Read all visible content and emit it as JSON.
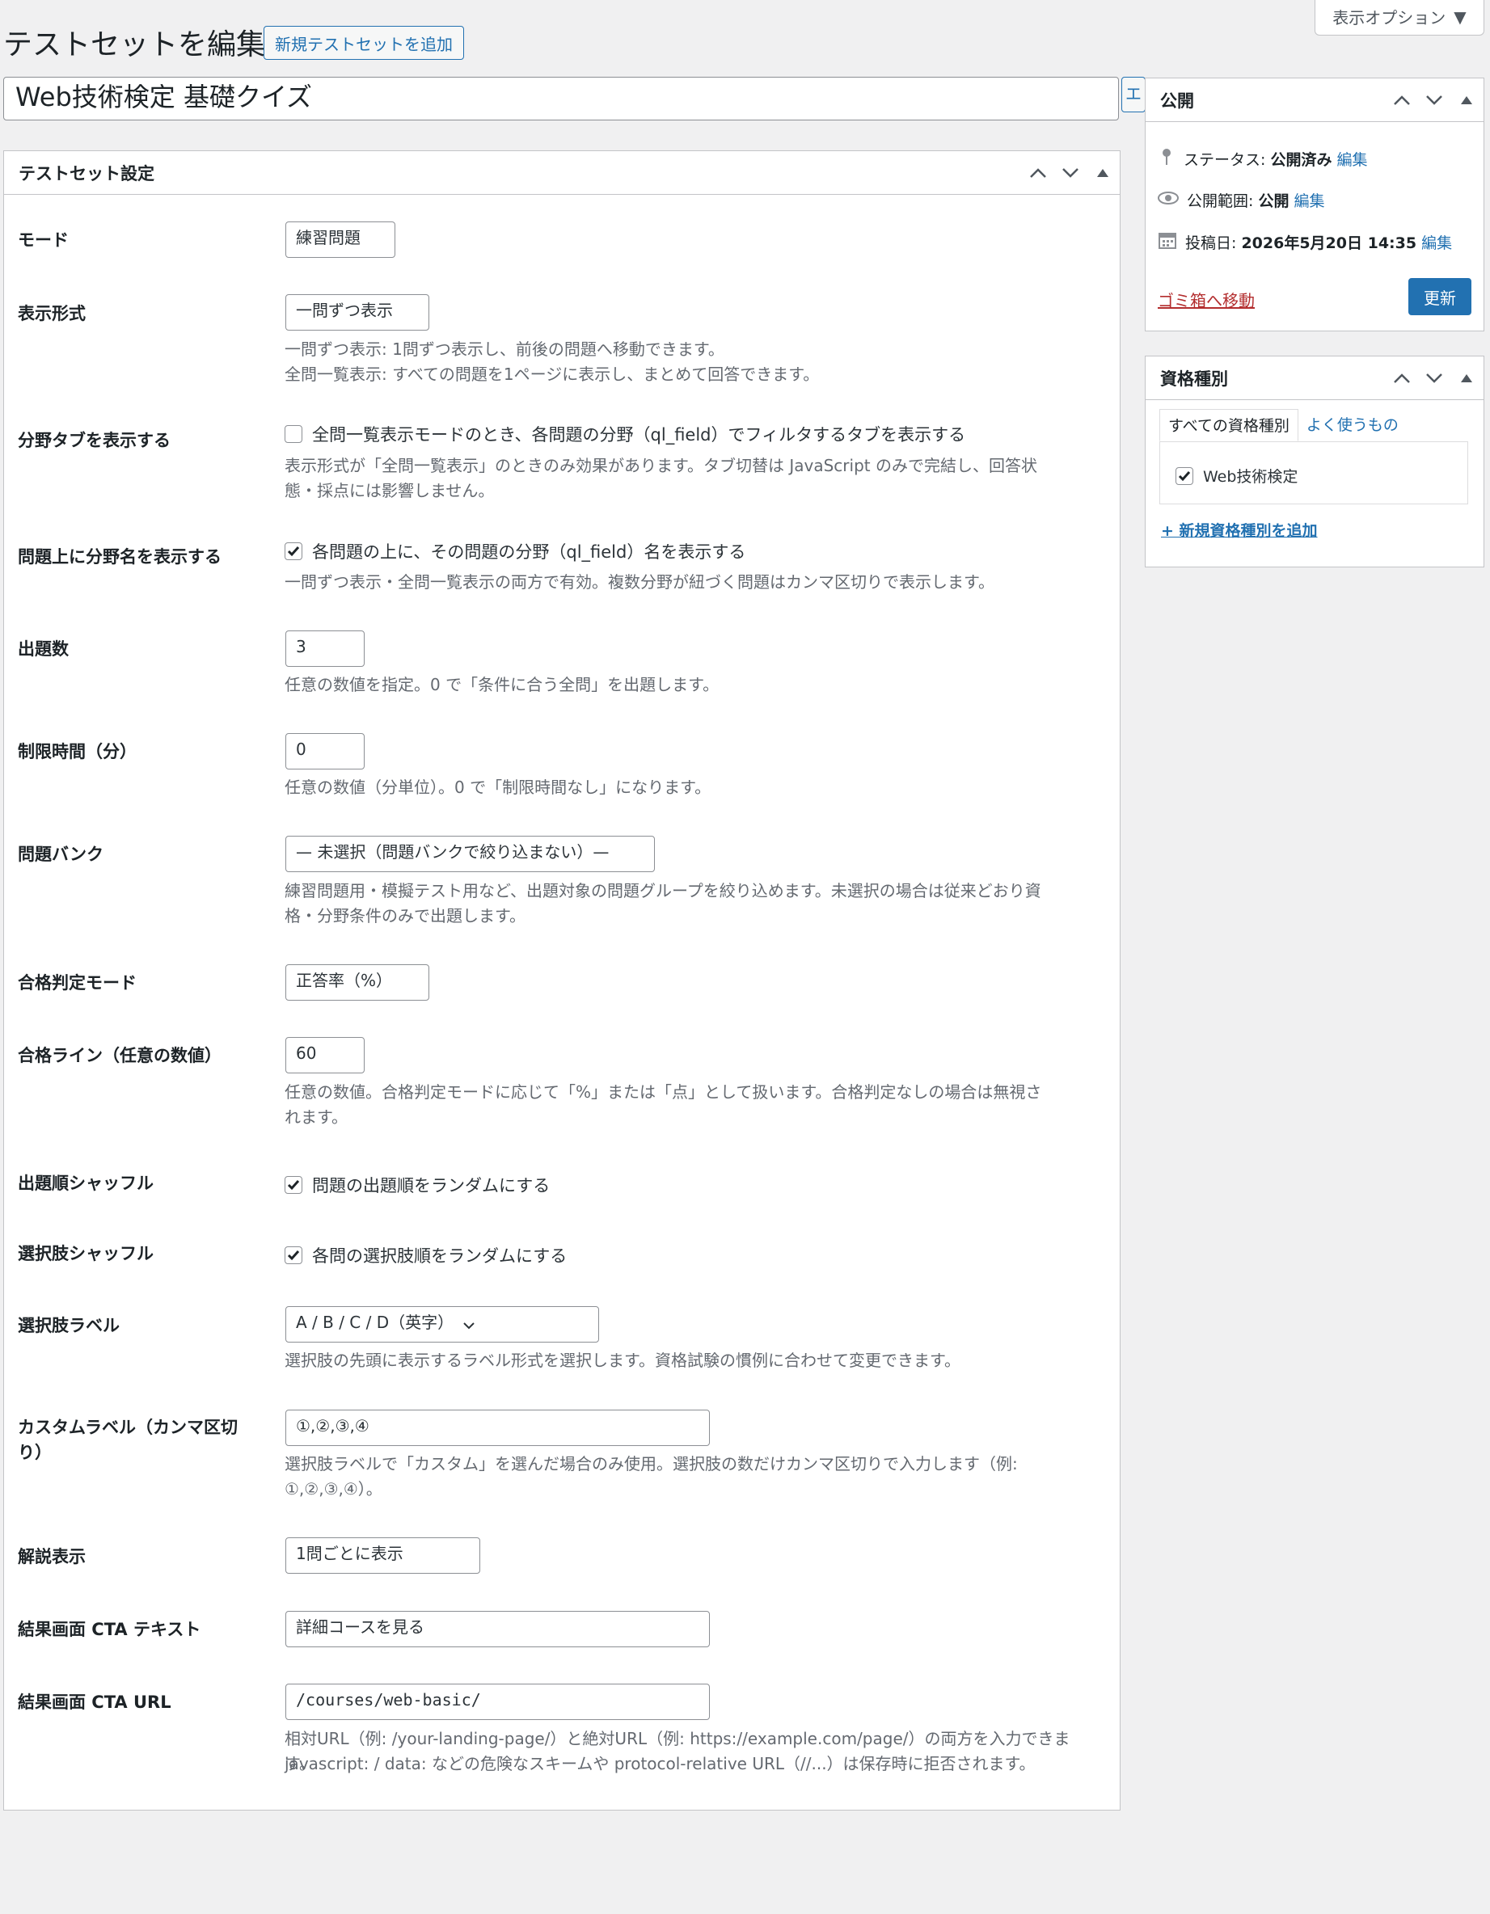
{
  "header": {
    "page_title": "テストセットを編集",
    "add_new_label": "新規テストセットを追加",
    "screen_options_label": "表示オプション"
  },
  "post": {
    "title_value": "Web技術検定 基礎クイズ",
    "title_side_button": "エ"
  },
  "settings_box": {
    "title": "テストセット設定",
    "rows": {
      "mode": {
        "label": "モード",
        "value": "練習問題"
      },
      "display": {
        "label": "表示形式",
        "value": "一問ずつ表示",
        "desc1": "一問ずつ表示: 1問ずつ表示し、前後の問題へ移動できます。",
        "desc2": "全問一覧表示: すべての問題を1ページに表示し、まとめて回答できます。"
      },
      "field_tabs": {
        "label": "分野タブを表示する",
        "checked": false,
        "cb_label": "全問一覧表示モードのとき、各問題の分野（ql_field）でフィルタするタブを表示する",
        "desc1": "表示形式が「全問一覧表示」のときのみ効果があります。タブ切替は JavaScript のみで完結し、回答状",
        "desc2": "態・採点には影響しません。"
      },
      "field_name": {
        "label": "問題上に分野名を表示する",
        "checked": true,
        "cb_label": "各問題の上に、その問題の分野（ql_field）名を表示する",
        "desc1": "一問ずつ表示・全問一覧表示の両方で有効。複数分野が紐づく問題はカンマ区切りで表示します。"
      },
      "count": {
        "label": "出題数",
        "value": "3",
        "desc1": "任意の数値を指定。0 で「条件に合う全問」を出題します。"
      },
      "time_limit": {
        "label": "制限時間（分）",
        "value": "0",
        "desc1": "任意の数値（分単位）。0 で「制限時間なし」になります。"
      },
      "bank": {
        "label": "問題バンク",
        "value": "— 未選択（問題バンクで絞り込まない）—",
        "desc1": "練習問題用・模擬テスト用など、出題対象の問題グループを絞り込めます。未選択の場合は従来どおり資",
        "desc2": "格・分野条件のみで出題します。"
      },
      "pass_mode": {
        "label": "合格判定モード",
        "value": "正答率（%）"
      },
      "pass_line": {
        "label": "合格ライン（任意の数値）",
        "value": "60",
        "desc1": "任意の数値。合格判定モードに応じて「%」または「点」として扱います。合格判定なしの場合は無視さ",
        "desc2": "れます。"
      },
      "shuffle_q": {
        "label": "出題順シャッフル",
        "checked": true,
        "cb_label": "問題の出題順をランダムにする"
      },
      "shuffle_c": {
        "label": "選択肢シャッフル",
        "checked": true,
        "cb_label": "各問の選択肢順をランダムにする"
      },
      "choice_label": {
        "label": "選択肢ラベル",
        "value": "A / B / C / D（英字）",
        "desc1": "選択肢の先頭に表示するラベル形式を選択します。資格試験の慣例に合わせて変更できます。"
      },
      "custom_label": {
        "label1": "カスタムラベル（カンマ区切",
        "label2": "り）",
        "value": "①,②,③,④",
        "desc1": "選択肢ラベルで「カスタム」を選んだ場合のみ使用。選択肢の数だけカンマ区切りで入力します（例:",
        "desc2": "①,②,③,④）。"
      },
      "explanation": {
        "label": "解説表示",
        "value": "1問ごとに表示"
      },
      "cta_text": {
        "label": "結果画面 CTA テキスト",
        "value": "詳細コースを見る"
      },
      "cta_url": {
        "label": "結果画面 CTA URL",
        "value": "/courses/web-basic/",
        "desc1": "相対URL（例: /your-landing-page/）と絶対URL（例: https://example.com/page/）の両方を入力できます。",
        "desc2": "javascript: / data: などの危険なスキームや protocol-relative URL（//...）は保存時に拒否されます。"
      }
    }
  },
  "publish_box": {
    "title": "公開",
    "status_label": "ステータス: ",
    "status_value": "公開済み",
    "visibility_label": "公開範囲: ",
    "visibility_value": "公開",
    "date_label": "投稿日: ",
    "date_value": "2026年5月20日 14:35",
    "edit_label": "編集",
    "trash_label": "ゴミ箱へ移動",
    "update_label": "更新"
  },
  "taxonomy_box": {
    "title": "資格種別",
    "tab_all": "すべての資格種別",
    "tab_popular": "よく使うもの",
    "terms": [
      {
        "label": "Web技術検定",
        "checked": true
      }
    ],
    "add_new_label": "+ 新規資格種別を追加"
  },
  "colors": {
    "accent": "#2271b1",
    "danger": "#b32d2e",
    "background": "#f0f0f1"
  },
  "icons": [
    "chevron-up-icon",
    "chevron-down-icon",
    "triangle-up-icon",
    "pin-icon",
    "eye-icon",
    "calendar-icon",
    "check-icon"
  ]
}
